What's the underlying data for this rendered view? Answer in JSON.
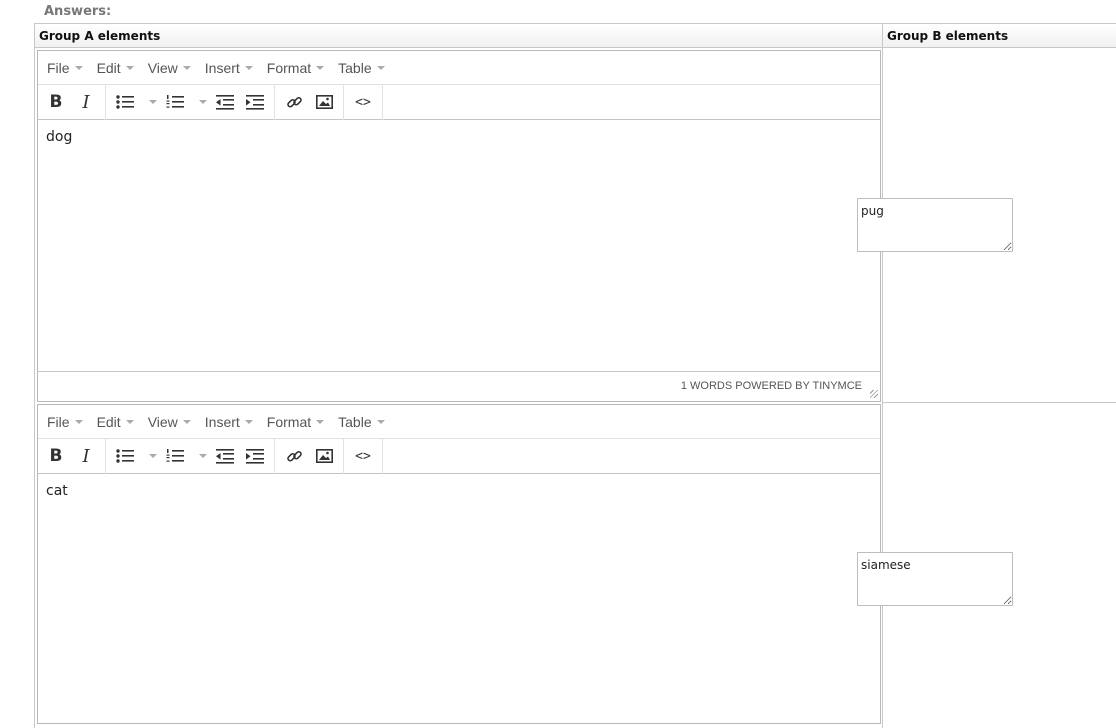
{
  "answers_label": "Answers:",
  "columns": {
    "group_a": "Group A elements",
    "group_b": "Group B elements"
  },
  "menu": [
    "File",
    "Edit",
    "View",
    "Insert",
    "Format",
    "Table"
  ],
  "icons": [
    "bold-icon",
    "italic-icon",
    "bullet-list-icon",
    "numbered-list-icon",
    "outdent-icon",
    "indent-icon",
    "link-icon",
    "image-icon",
    "code-icon"
  ],
  "rows": [
    {
      "editor_content": "dog",
      "status": "1 WORDS POWERED BY TINYMCE",
      "group_b_value": "pug"
    },
    {
      "editor_content": "cat",
      "group_b_value": "siamese"
    }
  ]
}
